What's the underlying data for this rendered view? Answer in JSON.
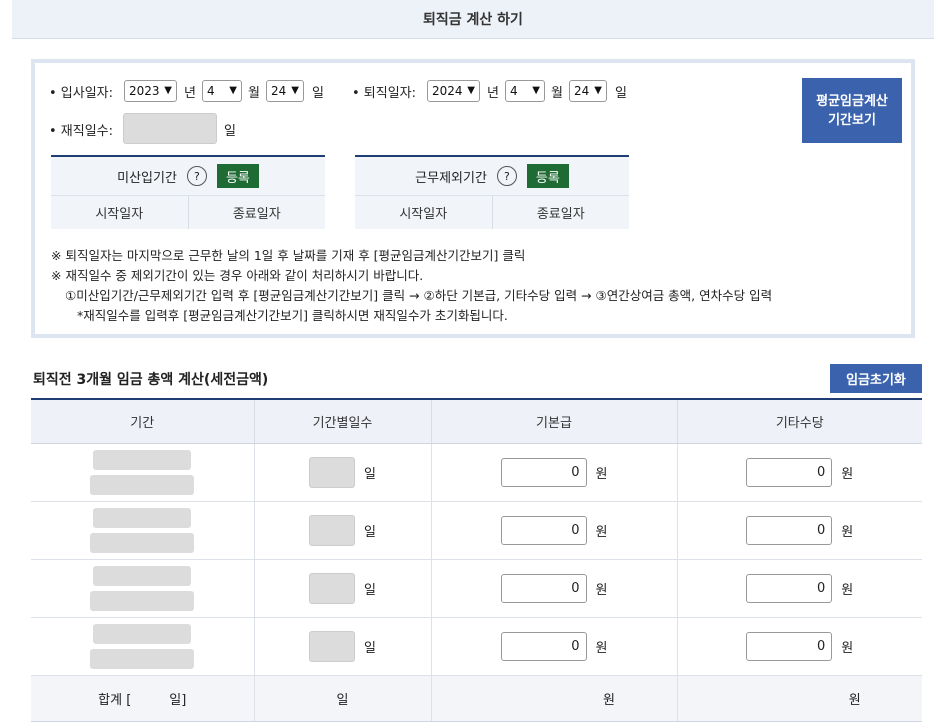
{
  "header": {
    "title": "퇴직금 계산 하기"
  },
  "dates": {
    "join_label": "• 입사일자:",
    "join_year": "2023",
    "join_month": "4",
    "join_day": "24",
    "leave_label": "• 퇴직일자:",
    "leave_year": "2024",
    "leave_month": "4",
    "leave_day": "24",
    "year_unit": "년",
    "month_unit": "월",
    "day_unit": "일",
    "days_label": "• 재직일수:",
    "days_unit": "일"
  },
  "avg_button": {
    "line1": "평균임금계산",
    "line2": "기간보기"
  },
  "unpaid": {
    "title": "미산입기간",
    "help": "?",
    "register": "등록",
    "start": "시작일자",
    "end": "종료일자"
  },
  "excluded": {
    "title": "근무제외기간",
    "help": "?",
    "register": "등록",
    "start": "시작일자",
    "end": "종료일자"
  },
  "notes": [
    "※ 퇴직일자는 마지막으로 근무한 날의 1일 후 날짜를 기재 후 [평균임금계산기간보기] 클릭",
    "※ 재직일수 중 제외기간이 있는 경우 아래와 같이 처리하시기 바랍니다.",
    "①미산입기간/근무제외기간 입력 후 [평균임금계산기간보기] 클릭 → ②하단 기본급, 기타수당 입력 → ③연간상여금 총액, 연차수당 입력",
    "*재직일수를 입력후 [평균임금계산기간보기] 클릭하시면 재직일수가 초기화됩니다."
  ],
  "section": {
    "title": "퇴직전 3개월 임금 총액 계산(세전금액)",
    "reset": "임금초기화"
  },
  "table": {
    "headers": [
      "기간",
      "기간별일수",
      "기본급",
      "기타수당"
    ],
    "rows": [
      {
        "base": "0",
        "other": "0"
      },
      {
        "base": "0",
        "other": "0"
      },
      {
        "base": "0",
        "other": "0"
      },
      {
        "base": "0",
        "other": "0"
      }
    ],
    "day_unit": "일",
    "won_unit": "원",
    "sum_label": "합계 [",
    "sum_label_end": "일]"
  }
}
